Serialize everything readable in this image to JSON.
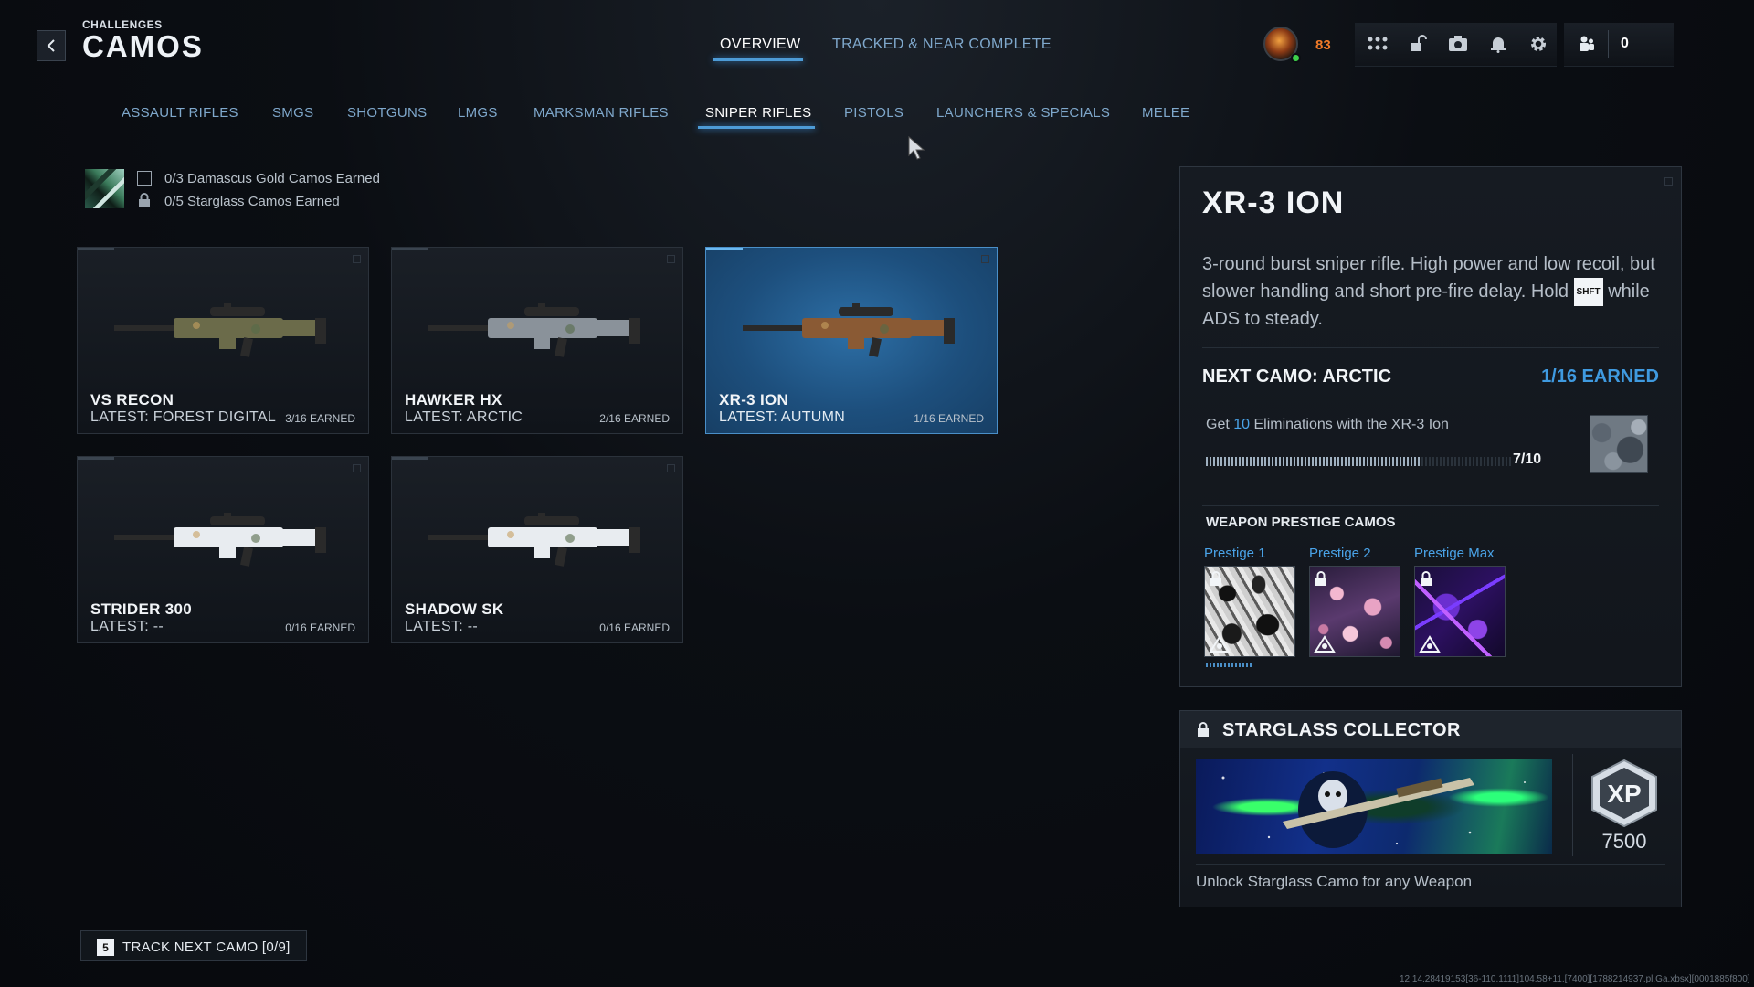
{
  "header": {
    "eyebrow": "CHALLENGES",
    "title": "CAMOS",
    "tabs": [
      {
        "label": "OVERVIEW",
        "active": true
      },
      {
        "label": "TRACKED & NEAR COMPLETE",
        "active": false
      }
    ],
    "player_level": "83",
    "friends_online": "0",
    "icons": [
      "menu-grid-icon",
      "unlock-icon",
      "camera-icon",
      "bell-icon",
      "gear-icon",
      "friends-icon"
    ]
  },
  "categories": [
    {
      "label": "ASSAULT RIFLES",
      "active": false
    },
    {
      "label": "SMGS",
      "active": false
    },
    {
      "label": "SHOTGUNS",
      "active": false
    },
    {
      "label": "LMGS",
      "active": false
    },
    {
      "label": "MARKSMAN RIFLES",
      "active": false
    },
    {
      "label": "SNIPER RIFLES",
      "active": true
    },
    {
      "label": "PISTOLS",
      "active": false
    },
    {
      "label": "LAUNCHERS & SPECIALS",
      "active": false
    },
    {
      "label": "MELEE",
      "active": false
    }
  ],
  "summary": {
    "damascus": "0/3 Damascus Gold Camos Earned",
    "starglass": "0/5 Starglass Camos Earned"
  },
  "weapons": [
    {
      "name": "VS RECON",
      "latest": "LATEST: FOREST DIGITAL",
      "earned": "3/16 EARNED",
      "selected": false,
      "camo": "#6b6b4a"
    },
    {
      "name": "HAWKER HX",
      "latest": "LATEST: ARCTIC",
      "earned": "2/16 EARNED",
      "selected": false,
      "camo": "#8a929a"
    },
    {
      "name": "XR-3 ION",
      "latest": "LATEST: AUTUMN",
      "earned": "1/16 EARNED",
      "selected": true,
      "camo": "#8a5a34"
    },
    {
      "name": "STRIDER 300",
      "latest": "LATEST: --",
      "earned": "0/16 EARNED",
      "selected": false,
      "camo": "#e8ecf0"
    },
    {
      "name": "SHADOW SK",
      "latest": "LATEST: --",
      "earned": "0/16 EARNED",
      "selected": false,
      "camo": "#e8ecf0"
    }
  ],
  "detail": {
    "title": "XR-3 ION",
    "description_1": "3-round burst sniper rifle. High power and low recoil, but slower handling and short pre-fire delay. Hold",
    "key": "SHFT",
    "description_2": "while ADS to steady.",
    "next_camo_label": "NEXT CAMO: ARCTIC",
    "next_camo_earned": "1/16 EARNED",
    "challenge_prefix": "Get",
    "challenge_count": "10",
    "challenge_suffix": "Eliminations with the XR-3 Ion",
    "progress_text": "7/10",
    "progress_fraction": 0.7,
    "prestige_heading": "WEAPON PRESTIGE CAMOS",
    "prestige": [
      {
        "label": "Prestige 1"
      },
      {
        "label": "Prestige 2"
      },
      {
        "label": "Prestige Max"
      }
    ]
  },
  "collector": {
    "title": "STARGLASS COLLECTOR",
    "xp_label": "XP",
    "xp_amount": "7500",
    "description": "Unlock Starglass Camo for any Weapon"
  },
  "footer": {
    "track_key": "5",
    "track_label": "TRACK NEXT CAMO [0/9]",
    "build_info": "12.14.28419153[36-110.1111]104.58+11.[7400][1788214937.pl.Ga.xbsx][0001885f800]"
  },
  "colors": {
    "accent_blue": "#4d9bd6",
    "level_orange": "#f07a28",
    "selected_card": "#2d6fa6"
  }
}
